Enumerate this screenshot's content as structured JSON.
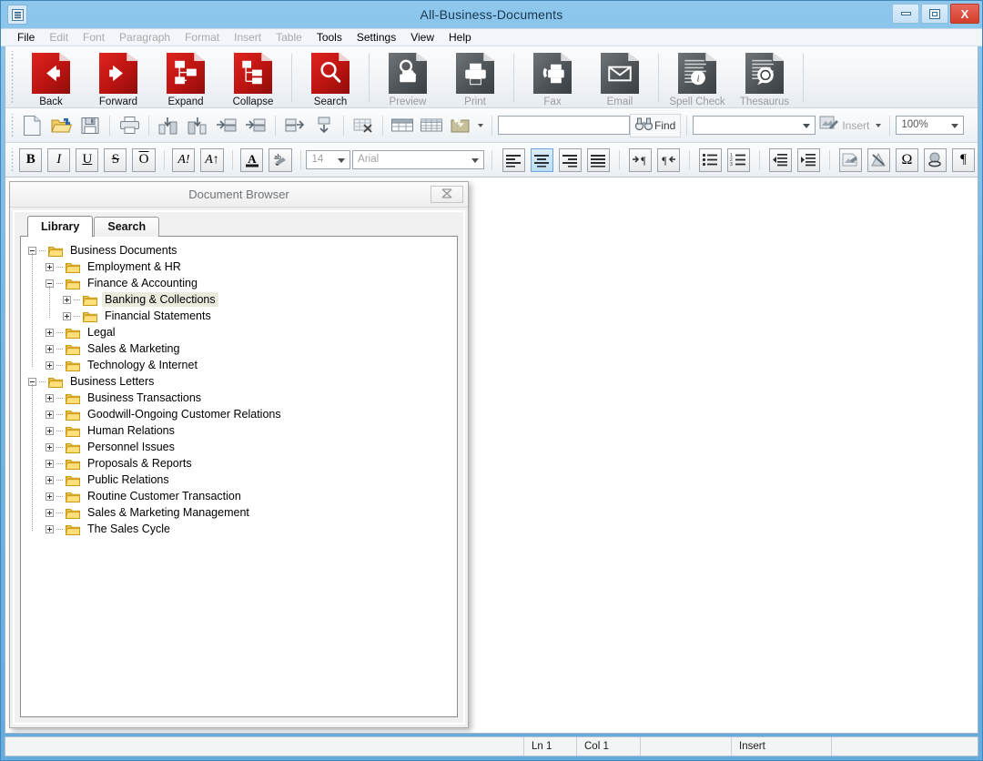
{
  "window": {
    "title": "All-Business-Documents",
    "sysmenu_icon": "menu-icon",
    "minimize_label": "",
    "maximize_label": "",
    "close_label": "X"
  },
  "menubar": {
    "items": [
      {
        "label": "File",
        "enabled": true
      },
      {
        "label": "Edit",
        "enabled": false
      },
      {
        "label": "Font",
        "enabled": false
      },
      {
        "label": "Paragraph",
        "enabled": false
      },
      {
        "label": "Format",
        "enabled": false
      },
      {
        "label": "Insert",
        "enabled": false
      },
      {
        "label": "Table",
        "enabled": false
      },
      {
        "label": "Tools",
        "enabled": true
      },
      {
        "label": "Settings",
        "enabled": true
      },
      {
        "label": "View",
        "enabled": true
      },
      {
        "label": "Help",
        "enabled": true
      }
    ]
  },
  "toolbar_main": {
    "buttons": [
      {
        "label": "Back",
        "icon": "arrow-left-icon",
        "color": "red",
        "enabled": true
      },
      {
        "label": "Forward",
        "icon": "arrow-right-icon",
        "color": "red",
        "enabled": true
      },
      {
        "label": "Expand",
        "icon": "expand-tree-icon",
        "color": "red",
        "enabled": true
      },
      {
        "label": "Collapse",
        "icon": "collapse-tree-icon",
        "color": "red",
        "enabled": true
      },
      {
        "label": "Search",
        "icon": "magnifier-icon",
        "color": "red",
        "enabled": true
      },
      {
        "label": "Preview",
        "icon": "print-preview-icon",
        "color": "grey",
        "enabled": false
      },
      {
        "label": "Print",
        "icon": "printer-icon",
        "color": "grey",
        "enabled": false
      },
      {
        "label": "Fax",
        "icon": "fax-icon",
        "color": "grey",
        "enabled": false
      },
      {
        "label": "Email",
        "icon": "envelope-icon",
        "color": "grey",
        "enabled": false
      },
      {
        "label": "Spell Check",
        "icon": "spell-check-icon",
        "color": "grey",
        "enabled": false
      },
      {
        "label": "Thesaurus",
        "icon": "thesaurus-icon",
        "color": "grey",
        "enabled": false
      }
    ]
  },
  "toolbar_small": {
    "icons": [
      "new-document-icon",
      "open-folder-icon",
      "save-disk-icon",
      "print-icon",
      "insert-column-left-icon",
      "insert-column-right-icon",
      "insert-row-above-icon",
      "insert-row-below-icon",
      "merge-cells-icon",
      "split-cells-icon",
      "delete-table-icon",
      "table-properties-icon",
      "insert-table-icon",
      "table-style-icon"
    ],
    "find_input_value": "",
    "find_button_label": "Find",
    "find_icon": "binoculars-icon",
    "style_combo_value": "",
    "insert_label": "Insert",
    "insert_icon": "insert-object-icon",
    "zoom_value": "100%"
  },
  "toolbar_format": {
    "bold": "B",
    "italic": "I",
    "underline": "U",
    "strikethrough": "S",
    "overline": "O",
    "font_grow": "A!",
    "font_shrink": "A↑",
    "font_color_icon": "font-color-icon",
    "highlight_icon": "text-highlight-icon",
    "font_size_value": "14",
    "font_name_value": "Arial",
    "align_left_icon": "align-left-icon",
    "align_center_icon": "align-center-icon",
    "align_right_icon": "align-right-icon",
    "align_justify_icon": "align-justify-icon",
    "ltr_icon": "text-direction-ltr-icon",
    "rtl_icon": "text-direction-rtl-icon",
    "bullet_list_icon": "bullet-list-icon",
    "numbered_list_icon": "numbered-list-icon",
    "outdent_icon": "decrease-indent-icon",
    "indent_icon": "increase-indent-icon",
    "insert_image_icon": "insert-image-icon",
    "insert_shape_icon": "insert-shape-icon",
    "symbol_icon": "omega-symbol-icon",
    "hyperlink_icon": "hyperlink-icon",
    "pilcrow_icon": "paragraph-marks-icon",
    "active_button": "align-center-icon"
  },
  "browser_panel": {
    "title": "Document Browser",
    "close_icon": "close-icon",
    "tabs": [
      {
        "label": "Library",
        "active": true
      },
      {
        "label": "Search",
        "active": false
      }
    ],
    "tree": [
      {
        "label": "Business Documents",
        "depth": 0,
        "state": "minus",
        "selected": false
      },
      {
        "label": "Employment & HR",
        "depth": 1,
        "state": "plus",
        "selected": false
      },
      {
        "label": "Finance & Accounting",
        "depth": 1,
        "state": "minus",
        "selected": false
      },
      {
        "label": "Banking & Collections",
        "depth": 2,
        "state": "plus",
        "selected": true
      },
      {
        "label": "Financial Statements",
        "depth": 2,
        "state": "plus",
        "selected": false
      },
      {
        "label": "Legal",
        "depth": 1,
        "state": "plus",
        "selected": false
      },
      {
        "label": "Sales & Marketing",
        "depth": 1,
        "state": "plus",
        "selected": false
      },
      {
        "label": "Technology & Internet",
        "depth": 1,
        "state": "plus",
        "selected": false
      },
      {
        "label": "Business Letters",
        "depth": 0,
        "state": "minus",
        "selected": false
      },
      {
        "label": "Business Transactions",
        "depth": 1,
        "state": "plus",
        "selected": false
      },
      {
        "label": "Goodwill-Ongoing Customer Relations",
        "depth": 1,
        "state": "plus",
        "selected": false
      },
      {
        "label": "Human Relations",
        "depth": 1,
        "state": "plus",
        "selected": false
      },
      {
        "label": "Personnel Issues",
        "depth": 1,
        "state": "plus",
        "selected": false
      },
      {
        "label": "Proposals & Reports",
        "depth": 1,
        "state": "plus",
        "selected": false
      },
      {
        "label": "Public Relations",
        "depth": 1,
        "state": "plus",
        "selected": false
      },
      {
        "label": "Routine Customer Transaction",
        "depth": 1,
        "state": "plus",
        "selected": false
      },
      {
        "label": "Sales & Marketing Management",
        "depth": 1,
        "state": "plus",
        "selected": false
      },
      {
        "label": "The Sales Cycle",
        "depth": 1,
        "state": "plus",
        "selected": false
      }
    ]
  },
  "statusbar": {
    "line": "Ln 1",
    "column": "Col 1",
    "blank": "",
    "mode": "Insert"
  },
  "colors": {
    "titlebar_blue": "#72b5e4",
    "accent_red": "#c4161c",
    "icon_grey": "#4e5457",
    "folder_yellow": "#ffd75e",
    "selection_beige": "#ece9dd",
    "close_button_red": "#d33d2c"
  }
}
